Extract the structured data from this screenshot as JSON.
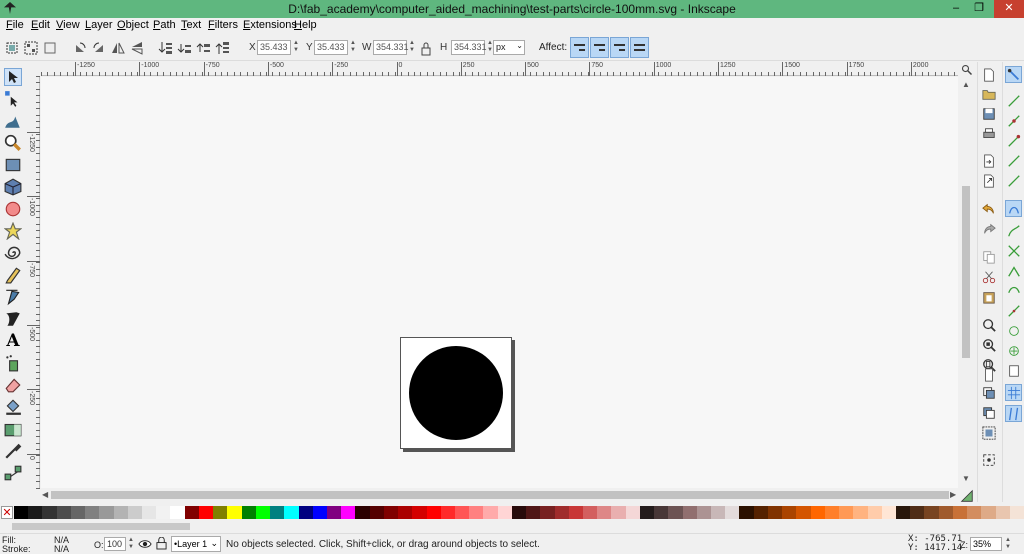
{
  "window": {
    "title": "D:\\fab_academy\\computer_aided_machining\\test-parts\\circle-100mm.svg - Inkscape",
    "minimize": "‒",
    "maximize": "❐",
    "close": "✕"
  },
  "menu": [
    "File",
    "Edit",
    "View",
    "Layer",
    "Object",
    "Path",
    "Text",
    "Filters",
    "Extensions",
    "Help"
  ],
  "controls": {
    "x_label": "X",
    "x_value": "35.433",
    "y_label": "Y",
    "y_value": "35.433",
    "w_label": "W",
    "w_value": "354.331",
    "h_label": "H",
    "h_value": "354.331",
    "unit": "px",
    "affect_label": "Affect:"
  },
  "ruler": {
    "h_labels": [
      "-1250",
      "-1000",
      "-750",
      "-500",
      "-250",
      "0",
      "250",
      "500",
      "750",
      "1000",
      "1250",
      "1500",
      "1750",
      "2000"
    ],
    "v_labels": [
      "-1250",
      "-1000",
      "-750",
      "-500",
      "-250",
      "0",
      "250"
    ]
  },
  "tools": [
    "selector-tool",
    "node-tool",
    "tweak-tool",
    "zoom-tool",
    "rectangle-tool",
    "3d-box-tool",
    "ellipse-tool",
    "star-tool",
    "spiral-tool",
    "pencil-tool",
    "pen-tool",
    "calligraphy-tool",
    "text-tool",
    "spray-tool",
    "eraser-tool",
    "paint-bucket-tool",
    "gradient-tool",
    "dropper-tool",
    "connector-tool"
  ],
  "text_tool_glyph": "A",
  "palette": {
    "none_mark": "✕",
    "colors": [
      "#000000",
      "#1a1a1a",
      "#333333",
      "#4d4d4d",
      "#666666",
      "#808080",
      "#999999",
      "#b3b3b3",
      "#cccccc",
      "#e6e6e6",
      "#f2f2f2",
      "#ffffff",
      "#800000",
      "#ff0000",
      "#808000",
      "#ffff00",
      "#008000",
      "#00ff00",
      "#008080",
      "#00ffff",
      "#000080",
      "#0000ff",
      "#800080",
      "#ff00ff",
      "#2b0000",
      "#550000",
      "#800000",
      "#aa0000",
      "#d40000",
      "#ff0000",
      "#ff2a2a",
      "#ff5555",
      "#ff8080",
      "#ffaaaa",
      "#ffd5d5",
      "#280b0b",
      "#501616",
      "#782121",
      "#a02c2c",
      "#c83737",
      "#d35f5f",
      "#de8787",
      "#e9afaf",
      "#f4d7d7",
      "#241c1c",
      "#483737",
      "#6c5353",
      "#916f6f",
      "#ac9393",
      "#c8b7b7",
      "#e3dbdb",
      "#2b1100",
      "#552200",
      "#803300",
      "#aa4400",
      "#d45500",
      "#ff6600",
      "#ff7f2a",
      "#ff9955",
      "#ffb380",
      "#ffccaa",
      "#ffe6d5",
      "#28170b",
      "#502d16",
      "#784421",
      "#a05a2c",
      "#c87137",
      "#d38d5f",
      "#deaa87",
      "#e9c6af",
      "#f4e3d7"
    ]
  },
  "status": {
    "fill_label": "Fill:",
    "fill_value": "N/A",
    "stroke_label": "Stroke:",
    "stroke_value": "N/A",
    "opacity_label": "O:",
    "opacity_value": "100",
    "layer": "•Layer 1",
    "message": "No objects selected. Click, Shift+click, or drag around objects to select.",
    "x_coord": "X: -765.71",
    "y_coord": "Y: 1417.14",
    "zoom_label": "Z:",
    "zoom_value": "35%"
  }
}
